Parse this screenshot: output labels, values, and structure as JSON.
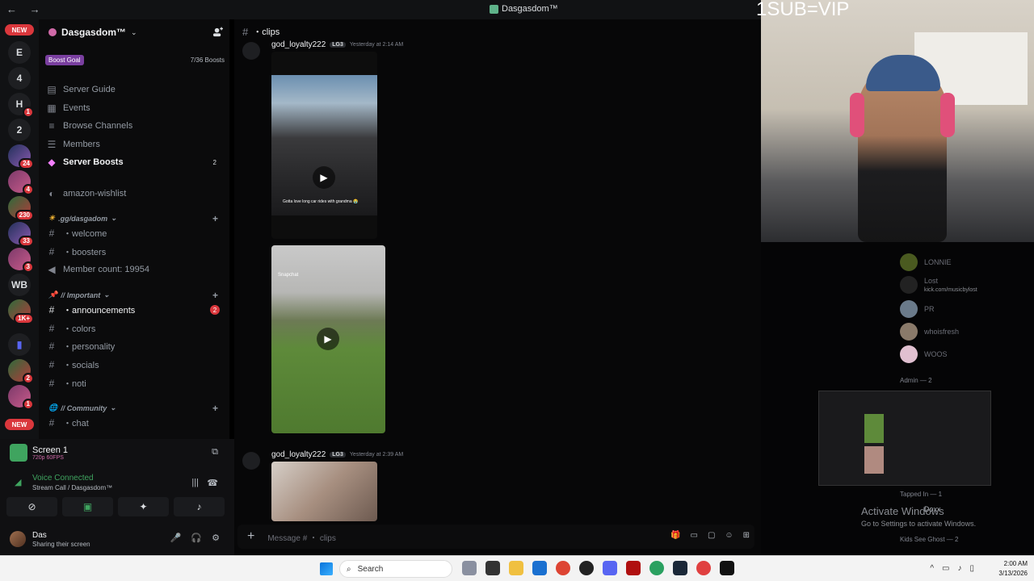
{
  "window": {
    "title": "Dasgasdom™"
  },
  "overlay": {
    "text": "1SUB=VIP"
  },
  "rail": {
    "new_top": "NEW",
    "new_bottom": "NEW",
    "letters": [
      "E",
      "4",
      "H",
      "2",
      "WB"
    ],
    "badges": [
      "1",
      "24",
      "4",
      "230",
      "33",
      "3",
      "1K+",
      "2",
      "1"
    ]
  },
  "guild": {
    "name": "Dasgasdom™",
    "boost_label": "Boost Goal",
    "boost_count": "7/36 Boosts",
    "menu": [
      {
        "label": "Server Guide"
      },
      {
        "label": "Events"
      },
      {
        "label": "Browse Channels"
      },
      {
        "label": "Members"
      },
      {
        "label": "Server Boosts",
        "count": "2"
      }
    ],
    "amazon": "amazon-wishlist",
    "cat_gg": ".gg/dasgadom",
    "gg_channels": [
      "welcome",
      "boosters"
    ],
    "member_count": "Member count: 19954",
    "cat_important": "// Important",
    "important_channels": [
      {
        "label": "announcements",
        "badge": "2"
      },
      {
        "label": "colors"
      },
      {
        "label": "personality"
      },
      {
        "label": "socials"
      },
      {
        "label": "noti"
      }
    ],
    "cat_community": "// Community",
    "community_channels": [
      "chat"
    ]
  },
  "voice": {
    "screen_title": "Screen 1",
    "screen_quality": "720p 60FPS",
    "status": "Voice Connected",
    "channel": "Stream Call / Dasgasdom™"
  },
  "user": {
    "name": "Das",
    "status": "Sharing their screen"
  },
  "chat": {
    "channel": "clips",
    "messages": [
      {
        "author": "god_loyalty222",
        "tag": "LG3",
        "time": "Yesterday at 2:14 AM",
        "video_caption": "Gotta love long car rides with grandma 😭"
      },
      {
        "author": "",
        "tag": "",
        "time": "",
        "video_caption": "Snapchat"
      },
      {
        "author": "god_loyalty222",
        "tag": "LG3",
        "time": "Yesterday at 2:39 AM"
      }
    ],
    "composer_placeholder": "Message # ・ clips"
  },
  "members": {
    "list": [
      {
        "name": "LONNIE"
      },
      {
        "name": "Lost",
        "sub": "kick.com/musicbylost"
      },
      {
        "name": "PR"
      },
      {
        "name": "whoisfresh"
      },
      {
        "name": "WOOS"
      }
    ],
    "group_admin": "Admin — 2",
    "group_tapped": "Tapped In — 1",
    "tapped_member": "Doxx",
    "group_kids": "Kids See Ghost — 2"
  },
  "watermark": {
    "line1": "Activate Windows",
    "line2": "Go to Settings to activate Windows."
  },
  "taskbar": {
    "search": "Search",
    "time": "2:00 AM",
    "date": "3/13/2026"
  },
  "colors": {
    "accent_red": "#da373c",
    "voice_green": "#3fa45f",
    "boost_purple": "#7a3fa0"
  }
}
